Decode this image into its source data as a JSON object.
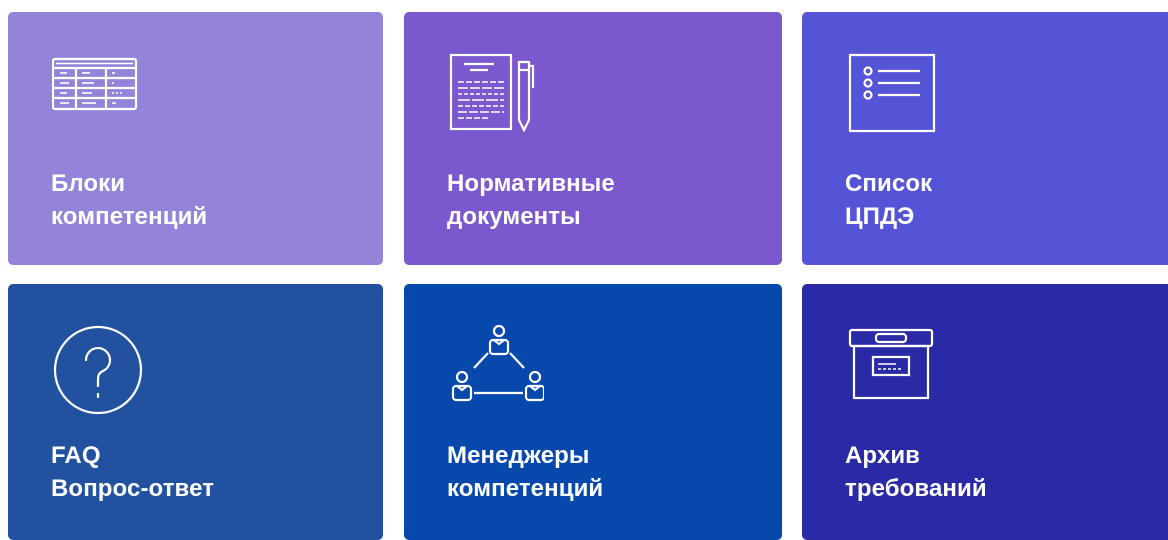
{
  "tiles": [
    {
      "line1": "Блоки",
      "line2": "компетенций",
      "color": "#9582D9",
      "icon": "table-icon"
    },
    {
      "line1": "Нормативные",
      "line2": "документы",
      "color": "#7B58CD",
      "icon": "document-pen-icon"
    },
    {
      "line1": "Список",
      "line2": "ЦПДЭ",
      "color": "#5654D6",
      "icon": "checklist-icon"
    },
    {
      "line1": "FAQ",
      "line2": "Вопрос-ответ",
      "color": "#22529F",
      "icon": "question-circle-icon"
    },
    {
      "line1": "Менеджеры",
      "line2": "компетенций",
      "color": "#0748AD",
      "icon": "people-network-icon"
    },
    {
      "line1": "Архив",
      "line2": "требований",
      "color": "#2B2AA6",
      "icon": "archive-box-icon"
    }
  ]
}
